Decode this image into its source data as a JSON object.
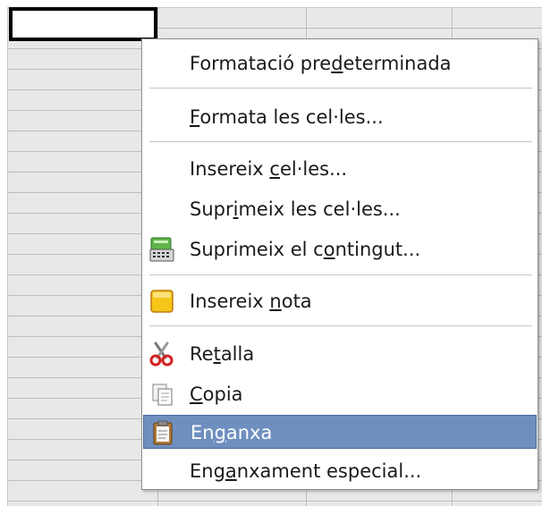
{
  "context_menu": {
    "items": [
      {
        "pre": "Formatació pre",
        "mn": "d",
        "post": "eterminada"
      },
      {
        "pre": "",
        "mn": "F",
        "post": "ormata les cel·les..."
      },
      {
        "pre": "Insereix ",
        "mn": "c",
        "post": "el·les..."
      },
      {
        "pre": "Supr",
        "mn": "i",
        "post": "meix les cel·les..."
      },
      {
        "pre": "Suprimeix el c",
        "mn": "o",
        "post": "ntingut..."
      },
      {
        "pre": "Insereix ",
        "mn": "n",
        "post": "ota"
      },
      {
        "pre": "Re",
        "mn": "t",
        "post": "alla"
      },
      {
        "pre": "",
        "mn": "C",
        "post": "opia"
      },
      {
        "pre": "En",
        "mn": "g",
        "post": "anxa"
      },
      {
        "pre": "Eng",
        "mn": "a",
        "post": "nxament especial..."
      }
    ],
    "highlighted_item": "Enganxa"
  },
  "icons": {
    "delete_contents": "eraser-calculator-icon",
    "insert_note": "note-icon",
    "cut": "scissors-icon",
    "copy": "copy-icon",
    "paste": "clipboard-icon"
  },
  "colors": {
    "highlight": "#6f8fbf",
    "grid": "#bdbdbd",
    "note_yellow": "#f5c518",
    "scissors_red": "#d32020"
  }
}
